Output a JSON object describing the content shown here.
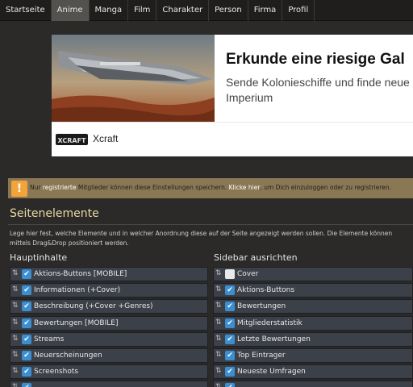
{
  "nav": {
    "items": [
      {
        "label": "Startseite",
        "active": false
      },
      {
        "label": "Anime",
        "active": true
      },
      {
        "label": "Manga",
        "active": false
      },
      {
        "label": "Film",
        "active": false
      },
      {
        "label": "Charakter",
        "active": false
      },
      {
        "label": "Person",
        "active": false
      },
      {
        "label": "Firma",
        "active": false
      },
      {
        "label": "Profil",
        "active": false
      }
    ]
  },
  "ad": {
    "headline": "Erkunde eine riesige Gal",
    "subline": "Sende Kolonieschiffe und finde neue Imperium",
    "brand": "Xcraft",
    "logo_text": "XCRAFT"
  },
  "notice": {
    "icon": "!",
    "prefix": "Nur ",
    "link1": "registrierte",
    "middle": " Mitglieder können diese Einstellungen speichern. ",
    "link2": "Klicke hier",
    "suffix": ", um Dich einzuloggen oder zu registrieren."
  },
  "section": {
    "title": "Seitenelemente",
    "description": "Lege hier fest, welche Elemente und in welcher Anordnung diese auf der Seite angezeigt werden sollen. Die Elemente können mittels Drag&Drop positioniert werden."
  },
  "main_column": {
    "title": "Hauptinhalte",
    "items": [
      {
        "label": "Aktions-Buttons [MOBILE]",
        "checked": true
      },
      {
        "label": "Informationen (+Cover)",
        "checked": true
      },
      {
        "label": "Beschreibung (+Cover +Genres)",
        "checked": true
      },
      {
        "label": "Bewertungen [MOBILE]",
        "checked": true
      },
      {
        "label": "Streams",
        "checked": true
      },
      {
        "label": "Neuerscheinungen",
        "checked": true
      },
      {
        "label": "Screenshots",
        "checked": true
      },
      {
        "label": "",
        "checked": true
      }
    ]
  },
  "sidebar_column": {
    "title": "Sidebar ausrichten",
    "items": [
      {
        "label": "Cover",
        "checked": false
      },
      {
        "label": "Aktions-Buttons",
        "checked": true
      },
      {
        "label": "Bewertungen",
        "checked": true
      },
      {
        "label": "Mitgliederstatistik",
        "checked": true
      },
      {
        "label": "Letzte Bewertungen",
        "checked": true
      },
      {
        "label": "Top Eintrager",
        "checked": true
      },
      {
        "label": "Neueste Umfragen",
        "checked": true
      },
      {
        "label": "",
        "checked": true
      }
    ]
  },
  "colors": {
    "checkbox_accent": "#3b8fd1",
    "notice_bg": "#8a7754",
    "notice_icon": "#f2a43a",
    "title_gold": "#e9d8a6"
  }
}
